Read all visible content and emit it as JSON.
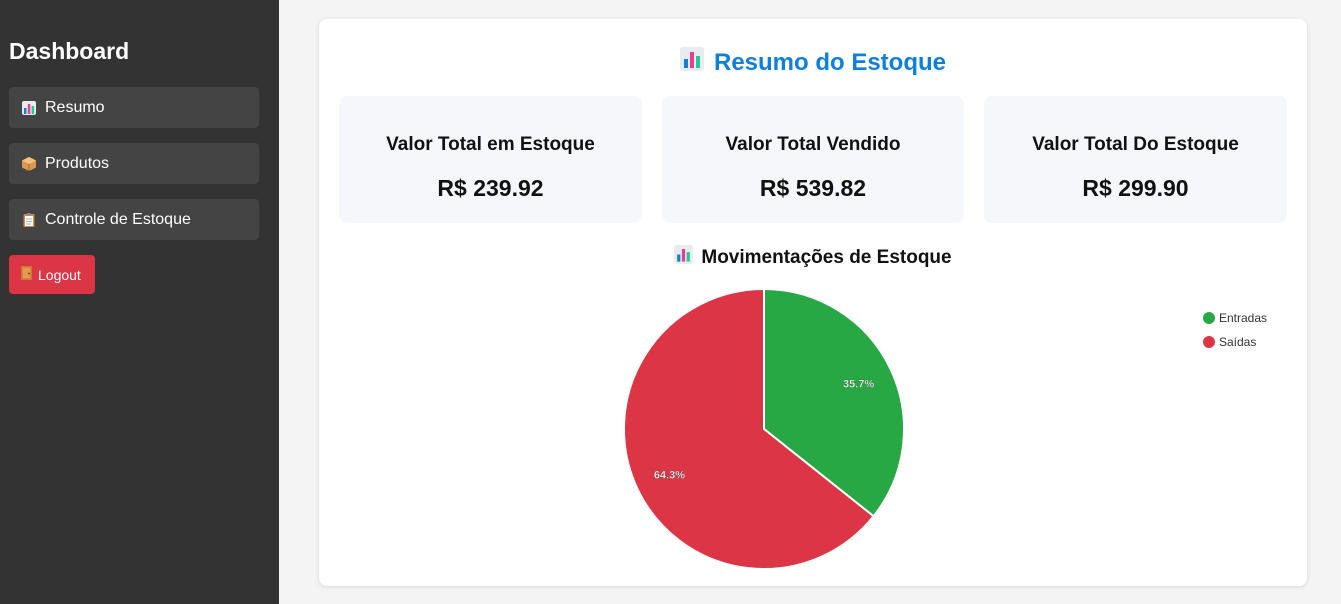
{
  "sidebar": {
    "title": "Dashboard",
    "items": [
      {
        "label": "Resumo",
        "icon": "bar-chart-icon"
      },
      {
        "label": "Produtos",
        "icon": "package-icon"
      },
      {
        "label": "Controle de Estoque",
        "icon": "clipboard-icon"
      }
    ],
    "logout": {
      "label": "Logout",
      "icon": "door-icon"
    }
  },
  "main": {
    "title": "Resumo do Estoque",
    "stats": [
      {
        "label": "Valor Total em Estoque",
        "value": "R$ 239.92"
      },
      {
        "label": "Valor Total Vendido",
        "value": "R$ 539.82"
      },
      {
        "label": "Valor Total Do Estoque",
        "value": "R$ 299.90"
      }
    ],
    "chart_title": "Movimentações de Estoque"
  },
  "chart_data": {
    "type": "pie",
    "categories": [
      "Entradas",
      "Saídas"
    ],
    "values": [
      35.7,
      64.3
    ],
    "labels": [
      "35.7%",
      "64.3%"
    ],
    "colors": [
      "#28a745",
      "#dc3545"
    ],
    "legend": "top-right"
  }
}
